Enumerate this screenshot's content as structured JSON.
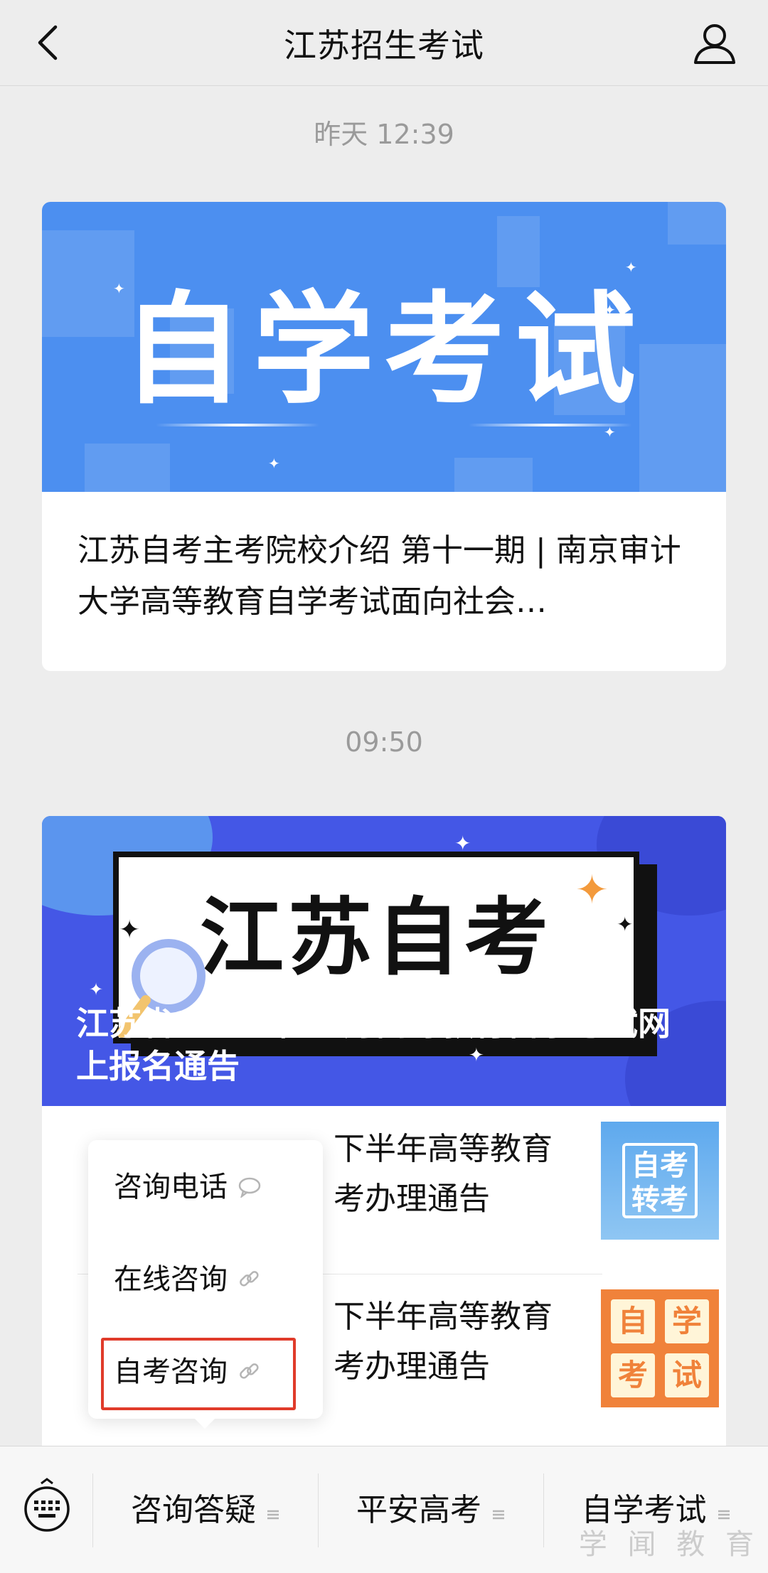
{
  "header": {
    "title": "江苏招生考试",
    "back_icon": "chevron-left-icon",
    "profile_icon": "user-icon"
  },
  "messages": [
    {
      "time": "昨天 12:39",
      "banner_text": "自学考试",
      "article_title": "江苏自考主考院校介绍 第十一期 | 南京审计大学高等教育自学考试面向社会…"
    },
    {
      "time": "09:50",
      "banner_text": "江苏自考",
      "banner_caption": "江苏省2026年10月高等教育自学考试网上报名通告",
      "sub_articles": [
        {
          "visible_text": "下半年高等教育\n考办理通告",
          "thumb_text": "自考转考"
        },
        {
          "visible_text": "下半年高等教育\n考办理通告",
          "thumb_chars": [
            "自",
            "学",
            "考",
            "试"
          ]
        }
      ]
    }
  ],
  "popup_menu": {
    "items": [
      {
        "label": "咨询电话",
        "icon": "message-bubble-icon"
      },
      {
        "label": "在线咨询",
        "icon": "link-icon"
      },
      {
        "label": "自考咨询",
        "icon": "link-icon",
        "highlighted": true
      }
    ]
  },
  "bottom_menu": {
    "keyboard_icon": "keyboard-icon",
    "tabs": [
      {
        "label": "咨询答疑",
        "icon": "menu-lines-icon"
      },
      {
        "label": "平安高考",
        "icon": "menu-lines-icon"
      },
      {
        "label": "自学考试",
        "icon": "menu-lines-icon"
      }
    ]
  },
  "watermark": "学 闻 教 育",
  "colors": {
    "background": "#ededed",
    "banner1": "#4c8ff0",
    "banner2": "#4457e6",
    "highlight": "#e03b2a",
    "orange_thumb": "#f0823a"
  }
}
